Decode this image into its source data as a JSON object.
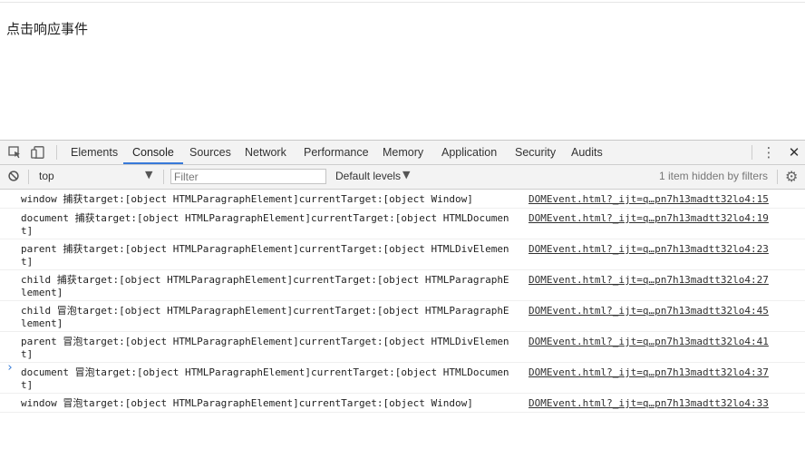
{
  "page": {
    "text": "点击响应事件"
  },
  "devtools": {
    "tabs": [
      {
        "label": "Elements",
        "active": false
      },
      {
        "label": "Console",
        "active": true
      },
      {
        "label": "Sources",
        "active": false
      },
      {
        "label": "Network",
        "active": false
      },
      {
        "label": "Performance",
        "active": false
      },
      {
        "label": "Memory",
        "active": false
      },
      {
        "label": "Application",
        "active": false
      },
      {
        "label": "Security",
        "active": false
      },
      {
        "label": "Audits",
        "active": false
      }
    ],
    "toolbar": {
      "context": "top",
      "filter_placeholder": "Filter",
      "levels": "Default levels",
      "hidden_info": "1 item hidden by filters"
    },
    "accent_color": "#3879d9",
    "icons": [
      "inspect-element-icon",
      "device-toggle-icon",
      "more-menu-icon",
      "close-icon",
      "clear-console-icon",
      "settings-gear-icon",
      "dropdown-arrow-icon",
      "prompt-chevron-icon"
    ],
    "console": [
      {
        "message": "window 捕获target:[object HTMLParagraphElement]currentTarget:[object Window]",
        "source": "DOMEvent.html?_ijt=q…pn7h13madtt32lo4:15"
      },
      {
        "message": "document 捕获target:[object HTMLParagraphElement]currentTarget:[object HTMLDocument]",
        "source": "DOMEvent.html?_ijt=q…pn7h13madtt32lo4:19"
      },
      {
        "message": "parent 捕获target:[object HTMLParagraphElement]currentTarget:[object HTMLDivElement]",
        "source": "DOMEvent.html?_ijt=q…pn7h13madtt32lo4:23"
      },
      {
        "message": "child 捕获target:[object HTMLParagraphElement]currentTarget:[object HTMLParagraphElement]",
        "source": "DOMEvent.html?_ijt=q…pn7h13madtt32lo4:27"
      },
      {
        "message": "child 冒泡target:[object HTMLParagraphElement]currentTarget:[object HTMLParagraphElement]",
        "source": "DOMEvent.html?_ijt=q…pn7h13madtt32lo4:45"
      },
      {
        "message": "parent 冒泡target:[object HTMLParagraphElement]currentTarget:[object HTMLDivElement]",
        "source": "DOMEvent.html?_ijt=q…pn7h13madtt32lo4:41"
      },
      {
        "message": "document 冒泡target:[object HTMLParagraphElement]currentTarget:[object HTMLDocument]",
        "source": "DOMEvent.html?_ijt=q…pn7h13madtt32lo4:37"
      },
      {
        "message": "window 冒泡target:[object HTMLParagraphElement]currentTarget:[object Window]",
        "source": "DOMEvent.html?_ijt=q…pn7h13madtt32lo4:33"
      }
    ]
  }
}
